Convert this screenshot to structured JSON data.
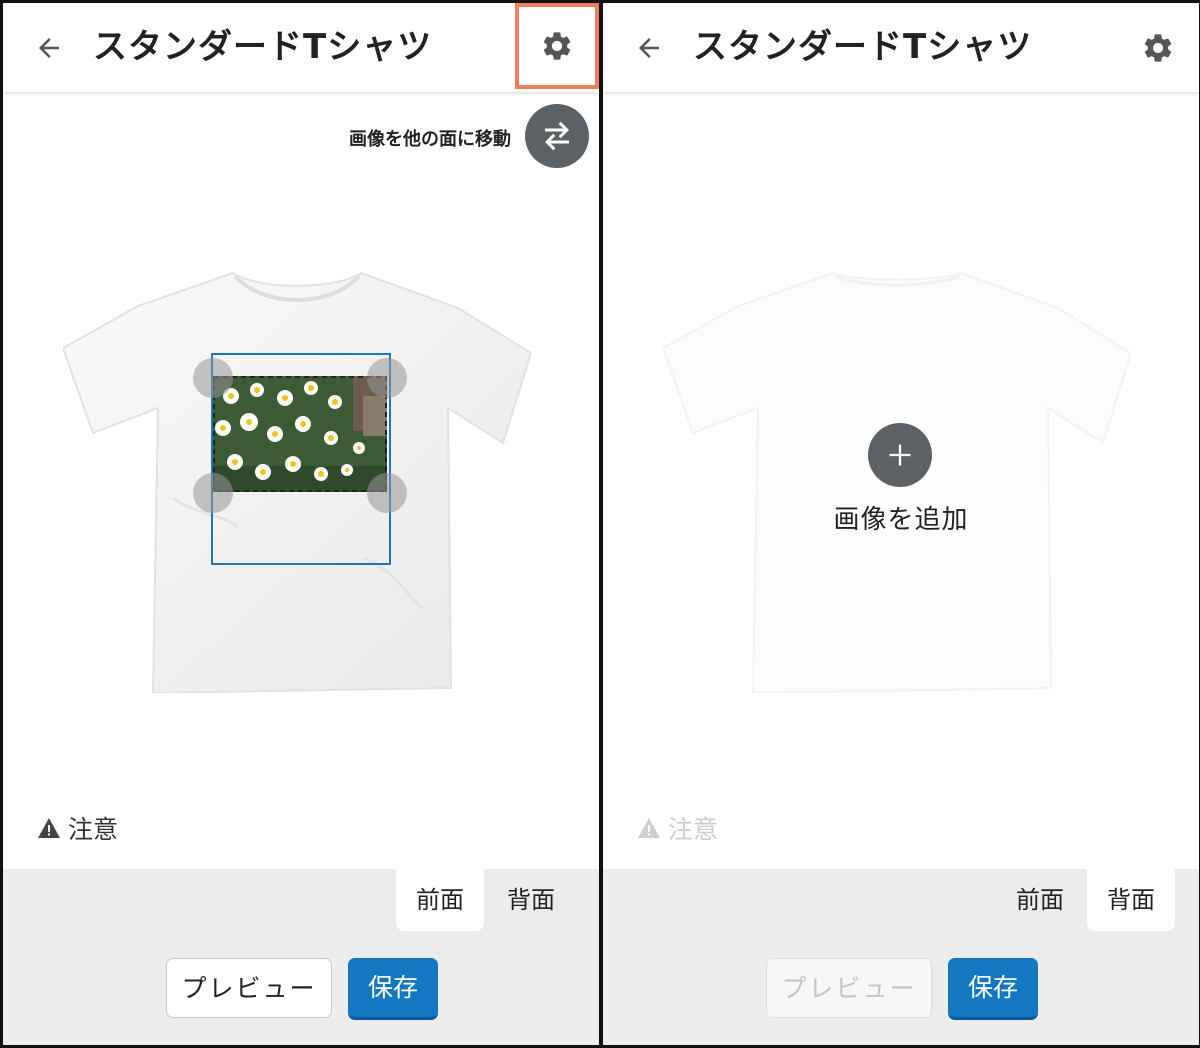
{
  "left_panel": {
    "header": {
      "title": "スタンダードTシャツ",
      "back_icon": "arrow-left-icon",
      "settings_icon": "gear-icon",
      "settings_highlighted": true,
      "highlight_color": "#ef7f5c"
    },
    "move_image_label": "画像を他の面に移動",
    "warning_label": "注意",
    "tabs": [
      {
        "label": "前面",
        "active": true
      },
      {
        "label": "背面",
        "active": false
      }
    ],
    "preview_label": "プレビュー",
    "save_label": "保存"
  },
  "right_panel": {
    "header": {
      "title": "スタンダードTシャツ",
      "back_icon": "arrow-left-icon",
      "settings_icon": "gear-icon"
    },
    "add_image_label": "画像を追加",
    "warning_label": "注意",
    "tabs": [
      {
        "label": "前面",
        "active": false
      },
      {
        "label": "背面",
        "active": true
      }
    ],
    "preview_label": "プレビュー",
    "save_label": "保存"
  },
  "colors": {
    "accent": "#1477c2",
    "icon_button": "#5c6165",
    "bottom_bar": "#ececec"
  }
}
